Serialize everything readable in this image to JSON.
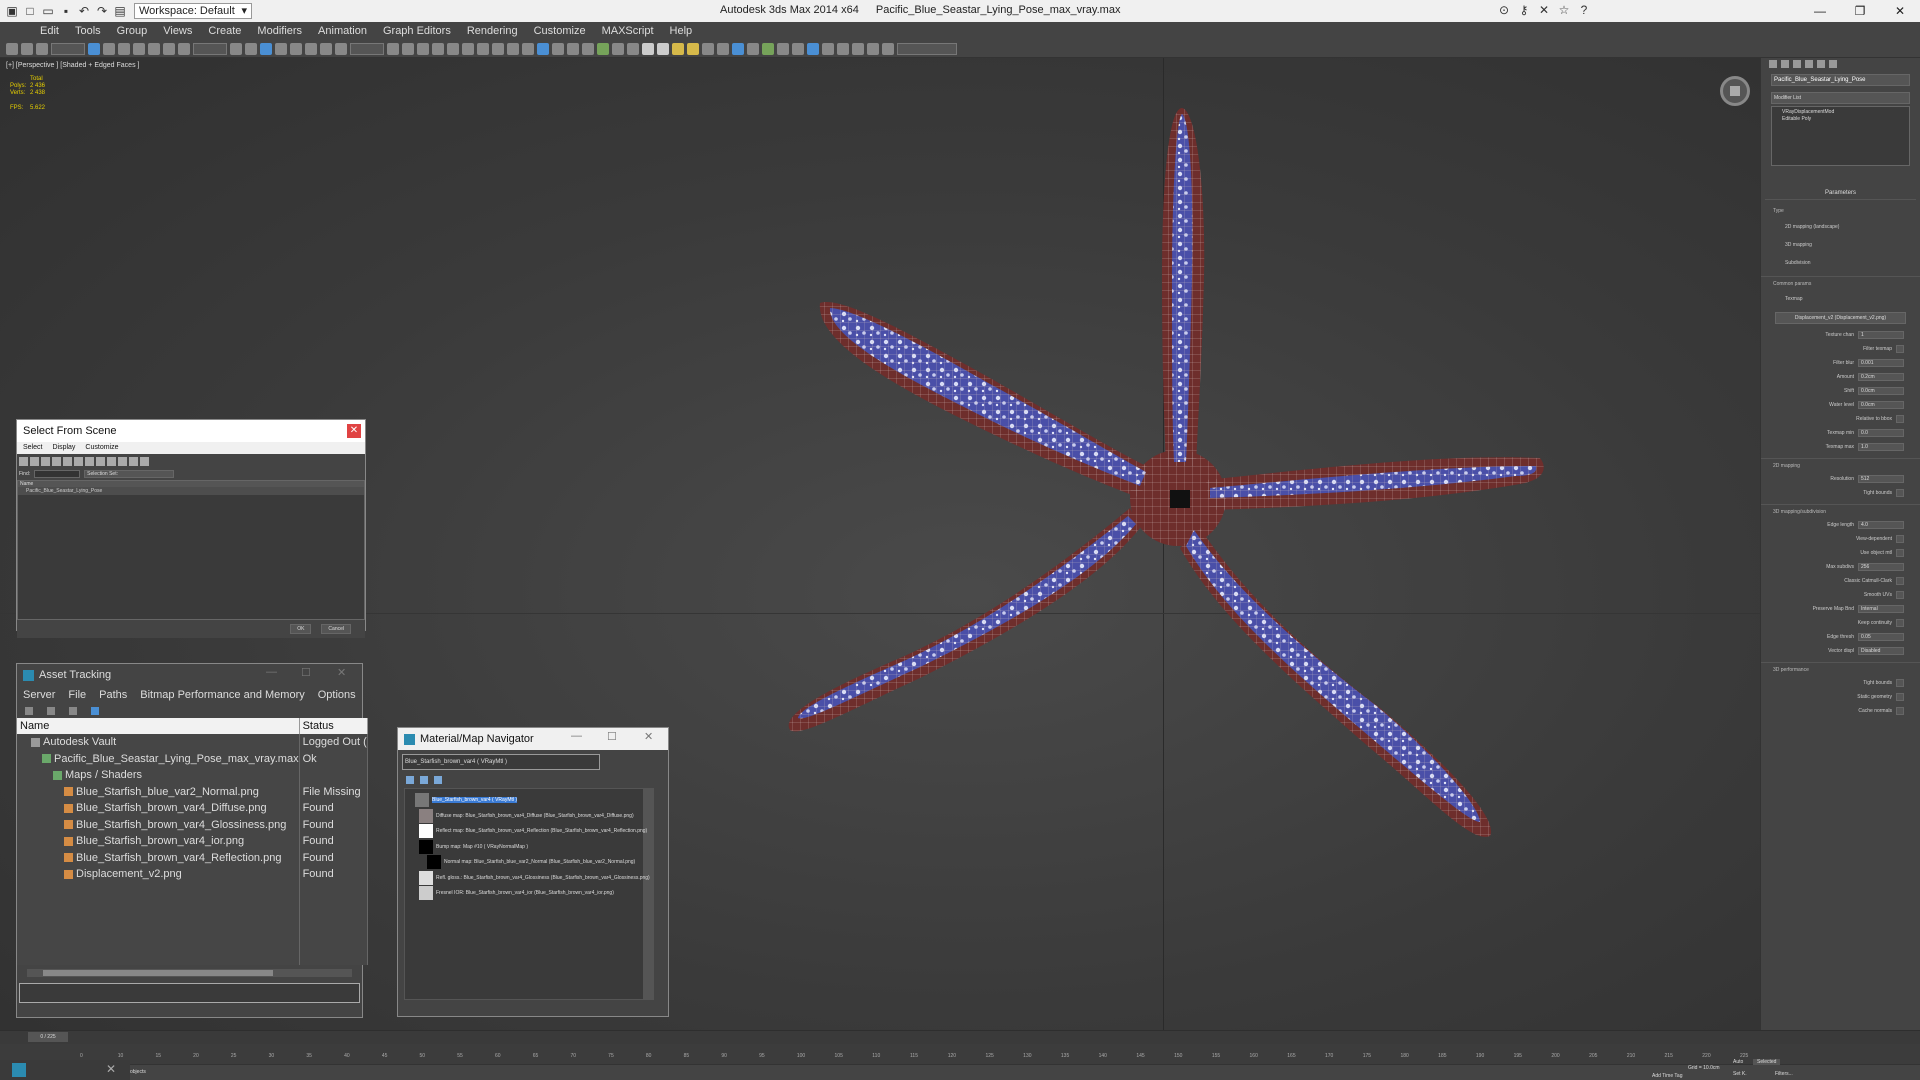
{
  "titlebar": {
    "workspace": "Workspace: Default",
    "app": "Autodesk 3ds Max  2014 x64",
    "file": "Pacific_Blue_Seastar_Lying_Pose_max_vray.max"
  },
  "menu": [
    "Edit",
    "Tools",
    "Group",
    "Views",
    "Create",
    "Modifiers",
    "Animation",
    "Graph Editors",
    "Rendering",
    "Customize",
    "MAXScript",
    "Help"
  ],
  "viewport": {
    "label": "[+] [Perspective ] [Shaded + Edged Faces ]",
    "stats": {
      "total_label": "Total",
      "polys_label": "Polys:",
      "polys": "2 436",
      "verts_label": "Verts:",
      "verts": "2 438",
      "fps_label": "FPS:",
      "fps": "5.622"
    }
  },
  "command_panel": {
    "object_name": "Pacific_Blue_Seastar_Lying_Pose",
    "modifier_list": "Modifier List",
    "stack": [
      "VRayDisplacementMod",
      "Editable Poly"
    ],
    "params_title": "Parameters",
    "type_label": "Type",
    "type_options": [
      "2D mapping (landscape)",
      "3D mapping",
      "Subdivision"
    ],
    "common_params": "Common params",
    "texmap_label": "Texmap",
    "texmap_value": "Displacement_v2 (Displacement_v2.png)",
    "rows": [
      {
        "label": "Texture chan",
        "value": "1"
      },
      {
        "label": "Filter texmap",
        "value": ""
      },
      {
        "label": "Filter blur",
        "value": "0.001"
      },
      {
        "label": "Amount",
        "value": "0.2cm"
      },
      {
        "label": "Shift",
        "value": "0.0cm"
      },
      {
        "label": "Water level",
        "value": "0.0cm"
      },
      {
        "label": "Relative to bbox",
        "value": ""
      },
      {
        "label": "Texmap min",
        "value": "0.0"
      },
      {
        "label": "Texmap max",
        "value": "1.0"
      }
    ],
    "sec_2d": "2D mapping",
    "rows_2d": [
      {
        "label": "Resolution",
        "value": "512"
      },
      {
        "label": "Tight bounds",
        "value": ""
      }
    ],
    "sec_3d": "3D mapping/subdivision",
    "rows_3d": [
      {
        "label": "Edge length",
        "value": "4.0"
      },
      {
        "label": "View-dependent",
        "value": ""
      },
      {
        "label": "Use object mtl",
        "value": ""
      },
      {
        "label": "Max subdivs",
        "value": "256"
      },
      {
        "label": "Classic Catmull-Clark",
        "value": ""
      },
      {
        "label": "Smooth UVs",
        "value": ""
      },
      {
        "label": "Preserve Map Bnd",
        "value": "Internal"
      },
      {
        "label": "Keep continuity",
        "value": ""
      },
      {
        "label": "Edge thresh",
        "value": "0.05"
      },
      {
        "label": "Vector displ",
        "value": "Disabled"
      }
    ],
    "sec_perf": "3D performance",
    "rows_perf": [
      {
        "label": "Tight bounds",
        "value": ""
      },
      {
        "label": "Static geometry",
        "value": ""
      },
      {
        "label": "Cache normals",
        "value": ""
      }
    ]
  },
  "select_from_scene": {
    "title": "Select From Scene",
    "menu": [
      "Select",
      "Display",
      "Customize"
    ],
    "find_label": "Find:",
    "selection_set": "Selection Set:",
    "column": "Name",
    "item": "Pacific_Blue_Seastar_Lying_Pose",
    "ok": "OK",
    "cancel": "Cancel"
  },
  "asset_tracking": {
    "title": "Asset Tracking",
    "menu": [
      "Server",
      "File",
      "Paths",
      "Bitmap Performance and Memory",
      "Options"
    ],
    "col_name": "Name",
    "col_status": "Status",
    "rows": [
      {
        "name": "Autodesk Vault",
        "status": "Logged Out (",
        "indent": 1
      },
      {
        "name": "Pacific_Blue_Seastar_Lying_Pose_max_vray.max",
        "status": "Ok",
        "indent": 2
      },
      {
        "name": "Maps / Shaders",
        "status": "",
        "indent": 3
      },
      {
        "name": "Blue_Starfish_blue_var2_Normal.png",
        "status": "File Missing",
        "indent": 4
      },
      {
        "name": "Blue_Starfish_brown_var4_Diffuse.png",
        "status": "Found",
        "indent": 4
      },
      {
        "name": "Blue_Starfish_brown_var4_Glossiness.png",
        "status": "Found",
        "indent": 4
      },
      {
        "name": "Blue_Starfish_brown_var4_ior.png",
        "status": "Found",
        "indent": 4
      },
      {
        "name": "Blue_Starfish_brown_var4_Reflection.png",
        "status": "Found",
        "indent": 4
      },
      {
        "name": "Displacement_v2.png",
        "status": "Found",
        "indent": 4
      }
    ]
  },
  "material_navigator": {
    "title": "Material/Map Navigator",
    "path": "Blue_Starfish_brown_var4  ( VRayMtl )",
    "nodes": [
      {
        "text": "Blue_Starfish_brown_var4  ( VRayMtl )",
        "swatch": "#777777"
      },
      {
        "text": "Diffuse map: Blue_Starfish_brown_var4_Diffuse (Blue_Starfish_brown_var4_Diffuse.png)",
        "swatch": "#8a8080"
      },
      {
        "text": "Reflect map: Blue_Starfish_brown_var4_Reflection (Blue_Starfish_brown_var4_Reflection.png)",
        "swatch": "#ffffff"
      },
      {
        "text": "Bump map: Map #10  ( VRayNormalMap )",
        "swatch": "#000000"
      },
      {
        "text": "Normal map: Blue_Starfish_blue_var2_Normal (Blue_Starfish_blue_var2_Normal.png)",
        "swatch": "#000000"
      },
      {
        "text": "Refl. gloss.: Blue_Starfish_brown_var4_Glossiness (Blue_Starfish_brown_var4_Glossiness.png)",
        "swatch": "#dddddd"
      },
      {
        "text": "Fresnel IOR: Blue_Starfish_brown_var4_ior (Blue_Starfish_brown_var4_ior.png)",
        "swatch": "#cccccc"
      }
    ]
  },
  "timeline": {
    "frame": "0 / 225",
    "ticks": [
      "0",
      "10",
      "15",
      "20",
      "25",
      "30",
      "35",
      "40",
      "45",
      "50",
      "55",
      "60",
      "65",
      "70",
      "75",
      "80",
      "85",
      "90",
      "95",
      "100",
      "105",
      "110",
      "115",
      "120",
      "125",
      "130",
      "135",
      "140",
      "145",
      "150",
      "155",
      "160",
      "165",
      "170",
      "175",
      "180",
      "185",
      "190",
      "195",
      "200",
      "205",
      "210",
      "215",
      "220",
      "225"
    ]
  },
  "status": {
    "objects": "objects",
    "grid": "Grid = 10.0cm",
    "auto": "Auto",
    "selected": "Selected",
    "set_key": "Set K.",
    "filters": "Filters...",
    "add_time_tag": "Add Time Tag"
  },
  "colors": {
    "starfish_red": "#6e2e2c",
    "starfish_blue": "#4a4fa8",
    "dialog_close": "#e04343"
  }
}
